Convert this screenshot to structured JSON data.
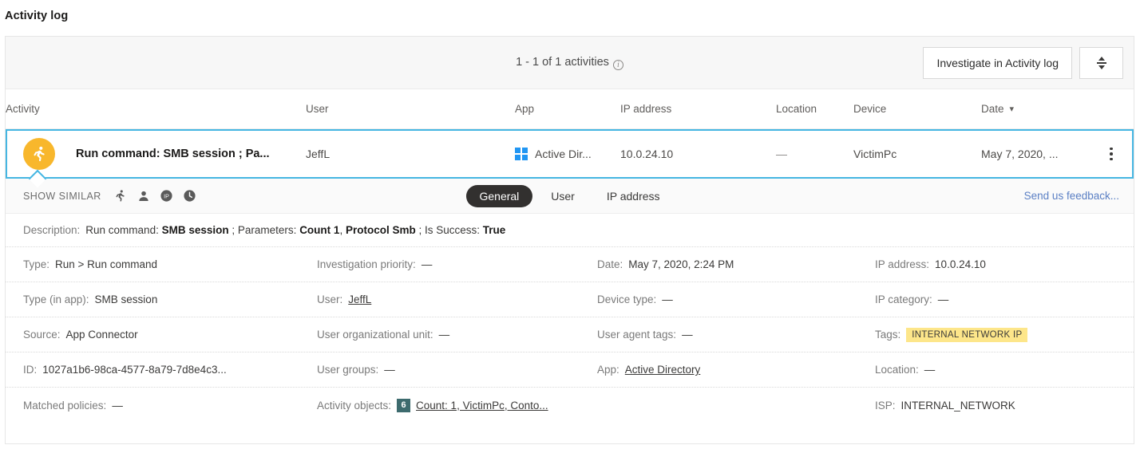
{
  "page_title": "Activity log",
  "toolbar": {
    "count_text": "1 - 1 of 1 activities",
    "info_icon": "info-icon",
    "investigate_label": "Investigate in Activity log",
    "expand_icon": "expand-collapse-icon"
  },
  "table": {
    "columns": [
      {
        "key": "activity",
        "label": "Activity"
      },
      {
        "key": "user",
        "label": "User"
      },
      {
        "key": "app",
        "label": "App"
      },
      {
        "key": "ip",
        "label": "IP address"
      },
      {
        "key": "location",
        "label": "Location"
      },
      {
        "key": "device",
        "label": "Device"
      },
      {
        "key": "date",
        "label": "Date",
        "sorted": true,
        "sort_icon": "chevron-down-icon"
      }
    ],
    "row": {
      "badge_icon": "running-person-icon",
      "badge_color": "#f8b72c",
      "activity": "Run command: SMB session ; Pa...",
      "user": "JeffL",
      "app_icon": "microsoft-windows-icon",
      "app": "Active Dir...",
      "ip": "10.0.24.10",
      "location": "—",
      "device": "VictimPc",
      "date": "May 7, 2020, ...",
      "menu_icon": "kebab-menu-icon"
    }
  },
  "subbar": {
    "show_similar_label": "SHOW SIMILAR",
    "similar_icons": [
      {
        "name": "running-person-icon"
      },
      {
        "name": "user-icon"
      },
      {
        "name": "ip-badge-icon"
      },
      {
        "name": "clock-icon"
      }
    ],
    "tabs": [
      {
        "label": "General",
        "active": true
      },
      {
        "label": "User",
        "active": false
      },
      {
        "label": "IP address",
        "active": false
      }
    ],
    "feedback_label": "Send us feedback..."
  },
  "description": {
    "label": "Description:",
    "prefix": "Run command:",
    "b1": "SMB session",
    "mid1": "; Parameters:",
    "b2": "Count 1",
    "comma": ",",
    "b3": "Protocol Smb",
    "mid2": "; Is Success:",
    "b4": "True"
  },
  "details": [
    [
      {
        "label": "Type:",
        "value": "Run > Run command"
      },
      {
        "label": "Investigation priority:",
        "value": "—"
      },
      {
        "label": "Date:",
        "value": "May 7, 2020, 2:24 PM"
      },
      {
        "label": "IP address:",
        "value": "10.0.24.10"
      }
    ],
    [
      {
        "label": "Type (in app):",
        "value": "SMB session"
      },
      {
        "label": "User:",
        "value": "JeffL",
        "link": true
      },
      {
        "label": "Device type:",
        "value": "—"
      },
      {
        "label": "IP category:",
        "value": "—"
      }
    ],
    [
      {
        "label": "Source:",
        "value": "App Connector"
      },
      {
        "label": "User organizational unit:",
        "value": "—"
      },
      {
        "label": "User agent tags:",
        "value": "—"
      },
      {
        "label": "Tags:",
        "value": "INTERNAL NETWORK IP",
        "badge": "tag"
      }
    ],
    [
      {
        "label": "ID:",
        "value": "1027a1b6-98ca-4577-8a79-7d8e4c3..."
      },
      {
        "label": "User groups:",
        "value": "—"
      },
      {
        "label": "App:",
        "value": "Active Directory",
        "link": true
      },
      {
        "label": "Location:",
        "value": "—"
      }
    ],
    [
      {
        "label": "Matched policies:",
        "value": "—"
      },
      {
        "label": "Activity objects:",
        "value": "Count: 1, VictimPc, Conto...",
        "link": true,
        "count_badge": "6"
      },
      {
        "label": "",
        "value": ""
      },
      {
        "label": "ISP:",
        "value": "INTERNAL_NETWORK"
      }
    ]
  ],
  "colors": {
    "selected_border": "#45b6e2",
    "badge_amber": "#f8b72c",
    "tag_yellow": "#fde68a",
    "count_badge": "#3d6b6e",
    "link_blue": "#5a7fc4",
    "tab_active": "#32302f"
  }
}
